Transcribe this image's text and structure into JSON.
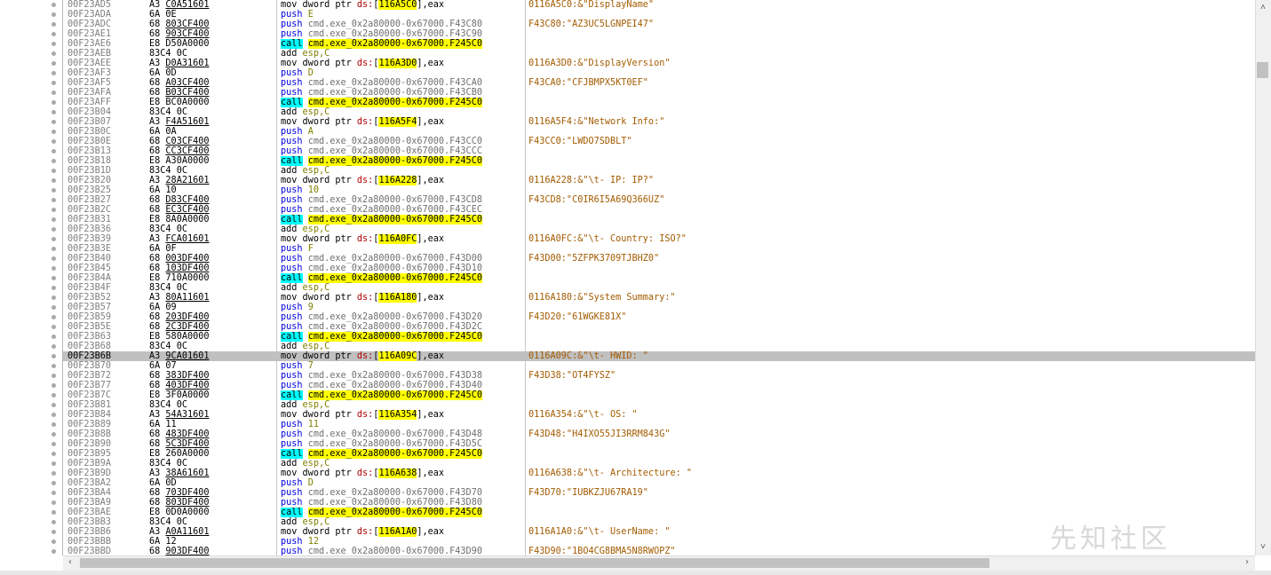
{
  "rows": [
    {
      "addr": "00F23AD5",
      "bp": true,
      "b1": "A3",
      "b2": "C0A51601",
      "u": true,
      "op": "mov",
      "ins": "mov",
      "a1": "dword ptr ",
      "seg": "ds:",
      "mem": "116A5C0",
      "tail": ",eax",
      "cmt": "0116A5C0:&\"DisplayName\""
    },
    {
      "addr": "00F23ADA",
      "bp": true,
      "b1": "6A",
      "b2": "0E",
      "u": false,
      "op": "push",
      "ins": "push",
      "a1": "E",
      "cmt": ""
    },
    {
      "addr": "00F23ADC",
      "bp": true,
      "b1": "68",
      "b2": "803CF400",
      "u": true,
      "op": "push",
      "ins": "push",
      "a1": "cmd.exe_0x2a80000-0x67000.F43C80",
      "cmt": "F43C80:\"AZ3UC5LGNPEI47\""
    },
    {
      "addr": "00F23AE1",
      "bp": true,
      "b1": "68",
      "b2": "903CF400",
      "u": true,
      "op": "push",
      "ins": "push",
      "a1": "cmd.exe_0x2a80000-0x67000.F43C90",
      "cmt": ""
    },
    {
      "addr": "00F23AE6",
      "bp": true,
      "b1": "E8",
      "b2": "D50A0000",
      "u": false,
      "op": "call",
      "ins": "call",
      "a1": "cmd.exe_0x2a80000-0x67000.F245C0",
      "cmt": ""
    },
    {
      "addr": "00F23AEB",
      "bp": true,
      "b1": "83C4",
      "b2": "0C",
      "u": false,
      "op": "add",
      "ins": "add",
      "a1": "esp,C",
      "cmt": ""
    },
    {
      "addr": "00F23AEE",
      "bp": true,
      "b1": "A3",
      "b2": "D0A31601",
      "u": true,
      "op": "mov",
      "ins": "mov",
      "a1": "dword ptr ",
      "seg": "ds:",
      "mem": "116A3D0",
      "tail": ",eax",
      "cmt": "0116A3D0:&\"DisplayVersion\""
    },
    {
      "addr": "00F23AF3",
      "bp": true,
      "b1": "6A",
      "b2": "0D",
      "u": false,
      "op": "push",
      "ins": "push",
      "a1": "D",
      "cmt": ""
    },
    {
      "addr": "00F23AF5",
      "bp": true,
      "b1": "68",
      "b2": "A03CF400",
      "u": true,
      "op": "push",
      "ins": "push",
      "a1": "cmd.exe_0x2a80000-0x67000.F43CA0",
      "cmt": "F43CA0:\"CFJBMPX5KT0EF\""
    },
    {
      "addr": "00F23AFA",
      "bp": true,
      "b1": "68",
      "b2": "B03CF400",
      "u": true,
      "op": "push",
      "ins": "push",
      "a1": "cmd.exe_0x2a80000-0x67000.F43CB0",
      "cmt": ""
    },
    {
      "addr": "00F23AFF",
      "bp": true,
      "b1": "E8",
      "b2": "BC0A0000",
      "u": false,
      "op": "call",
      "ins": "call",
      "a1": "cmd.exe_0x2a80000-0x67000.F245C0",
      "cmt": ""
    },
    {
      "addr": "00F23B04",
      "bp": true,
      "b1": "83C4",
      "b2": "0C",
      "u": false,
      "op": "add",
      "ins": "add",
      "a1": "esp,C",
      "cmt": ""
    },
    {
      "addr": "00F23B07",
      "bp": true,
      "b1": "A3",
      "b2": "F4A51601",
      "u": true,
      "op": "mov",
      "ins": "mov",
      "a1": "dword ptr ",
      "seg": "ds:",
      "mem": "116A5F4",
      "tail": ",eax",
      "cmt": "0116A5F4:&\"Network Info:\""
    },
    {
      "addr": "00F23B0C",
      "bp": true,
      "b1": "6A",
      "b2": "0A",
      "u": false,
      "op": "push",
      "ins": "push",
      "a1": "A",
      "cmt": ""
    },
    {
      "addr": "00F23B0E",
      "bp": true,
      "b1": "68",
      "b2": "C03CF400",
      "u": true,
      "op": "push",
      "ins": "push",
      "a1": "cmd.exe_0x2a80000-0x67000.F43CC0",
      "cmt": "F43CC0:\"LWDO7SDBLT\""
    },
    {
      "addr": "00F23B13",
      "bp": true,
      "b1": "68",
      "b2": "CC3CF400",
      "u": true,
      "op": "push",
      "ins": "push",
      "a1": "cmd.exe_0x2a80000-0x67000.F43CCC",
      "cmt": ""
    },
    {
      "addr": "00F23B18",
      "bp": true,
      "b1": "E8",
      "b2": "A30A0000",
      "u": false,
      "op": "call",
      "ins": "call",
      "a1": "cmd.exe_0x2a80000-0x67000.F245C0",
      "cmt": ""
    },
    {
      "addr": "00F23B1D",
      "bp": true,
      "b1": "83C4",
      "b2": "0C",
      "u": false,
      "op": "add",
      "ins": "add",
      "a1": "esp,C",
      "cmt": ""
    },
    {
      "addr": "00F23B20",
      "bp": true,
      "b1": "A3",
      "b2": "28A21601",
      "u": true,
      "op": "mov",
      "ins": "mov",
      "a1": "dword ptr ",
      "seg": "ds:",
      "mem": "116A228",
      "tail": ",eax",
      "cmt": "0116A228:&\"\\t- IP: IP?\""
    },
    {
      "addr": "00F23B25",
      "bp": true,
      "b1": "6A",
      "b2": "10",
      "u": false,
      "op": "push",
      "ins": "push",
      "a1": "10",
      "cmt": ""
    },
    {
      "addr": "00F23B27",
      "bp": true,
      "b1": "68",
      "b2": "D83CF400",
      "u": true,
      "op": "push",
      "ins": "push",
      "a1": "cmd.exe_0x2a80000-0x67000.F43CD8",
      "cmt": "F43CD8:\"C0IR6I5A69Q366UZ\""
    },
    {
      "addr": "00F23B2C",
      "bp": true,
      "b1": "68",
      "b2": "EC3CF400",
      "u": true,
      "op": "push",
      "ins": "push",
      "a1": "cmd.exe_0x2a80000-0x67000.F43CEC",
      "cmt": ""
    },
    {
      "addr": "00F23B31",
      "bp": true,
      "b1": "E8",
      "b2": "8A0A0000",
      "u": false,
      "op": "call",
      "ins": "call",
      "a1": "cmd.exe_0x2a80000-0x67000.F245C0",
      "cmt": ""
    },
    {
      "addr": "00F23B36",
      "bp": true,
      "b1": "83C4",
      "b2": "0C",
      "u": false,
      "op": "add",
      "ins": "add",
      "a1": "esp,C",
      "cmt": ""
    },
    {
      "addr": "00F23B39",
      "bp": true,
      "b1": "A3",
      "b2": "FCA01601",
      "u": true,
      "op": "mov",
      "ins": "mov",
      "a1": "dword ptr ",
      "seg": "ds:",
      "mem": "116A0FC",
      "tail": ",eax",
      "cmt": "0116A0FC:&\"\\t- Country: ISO?\""
    },
    {
      "addr": "00F23B3E",
      "bp": true,
      "b1": "6A",
      "b2": "0F",
      "u": false,
      "op": "push",
      "ins": "push",
      "a1": "F",
      "cmt": ""
    },
    {
      "addr": "00F23B40",
      "bp": true,
      "b1": "68",
      "b2": "003DF400",
      "u": true,
      "op": "push",
      "ins": "push",
      "a1": "cmd.exe_0x2a80000-0x67000.F43D00",
      "cmt": "F43D00:\"5ZFPK3709TJBHZ0\""
    },
    {
      "addr": "00F23B45",
      "bp": true,
      "b1": "68",
      "b2": "103DF400",
      "u": true,
      "op": "push",
      "ins": "push",
      "a1": "cmd.exe_0x2a80000-0x67000.F43D10",
      "cmt": ""
    },
    {
      "addr": "00F23B4A",
      "bp": true,
      "b1": "E8",
      "b2": "710A0000",
      "u": false,
      "op": "call",
      "ins": "call",
      "a1": "cmd.exe_0x2a80000-0x67000.F245C0",
      "cmt": ""
    },
    {
      "addr": "00F23B4F",
      "bp": true,
      "b1": "83C4",
      "b2": "0C",
      "u": false,
      "op": "add",
      "ins": "add",
      "a1": "esp,C",
      "cmt": ""
    },
    {
      "addr": "00F23B52",
      "bp": true,
      "b1": "A3",
      "b2": "80A11601",
      "u": true,
      "op": "mov",
      "ins": "mov",
      "a1": "dword ptr ",
      "seg": "ds:",
      "mem": "116A180",
      "tail": ",eax",
      "cmt": "0116A180:&\"System Summary:\""
    },
    {
      "addr": "00F23B57",
      "bp": true,
      "b1": "6A",
      "b2": "09",
      "u": false,
      "op": "push",
      "ins": "push",
      "a1": "9",
      "cmt": ""
    },
    {
      "addr": "00F23B59",
      "bp": true,
      "b1": "68",
      "b2": "203DF400",
      "u": true,
      "op": "push",
      "ins": "push",
      "a1": "cmd.exe_0x2a80000-0x67000.F43D20",
      "cmt": "F43D20:\"61WGKE81X\""
    },
    {
      "addr": "00F23B5E",
      "bp": true,
      "b1": "68",
      "b2": "2C3DF400",
      "u": true,
      "op": "push",
      "ins": "push",
      "a1": "cmd.exe_0x2a80000-0x67000.F43D2C",
      "cmt": ""
    },
    {
      "addr": "00F23B63",
      "bp": true,
      "b1": "E8",
      "b2": "580A0000",
      "u": false,
      "op": "call",
      "ins": "call",
      "a1": "cmd.exe_0x2a80000-0x67000.F245C0",
      "cmt": ""
    },
    {
      "addr": "00F23B68",
      "bp": true,
      "b1": "83C4",
      "b2": "0C",
      "u": false,
      "op": "add",
      "ins": "add",
      "a1": "esp,C",
      "cmt": ""
    },
    {
      "addr": "00F23B6B",
      "bp": true,
      "sel": true,
      "b1": "A3",
      "b2": "9CA01601",
      "u": true,
      "op": "mov",
      "ins": "mov",
      "a1": "dword ptr ",
      "seg": "ds:",
      "mem": "116A09C",
      "tail": ",eax",
      "cmt": "0116A09C:&\"\\t- HWID: \""
    },
    {
      "addr": "00F23B70",
      "bp": true,
      "b1": "6A",
      "b2": "07",
      "u": false,
      "op": "push",
      "ins": "push",
      "a1": "7",
      "cmt": ""
    },
    {
      "addr": "00F23B72",
      "bp": true,
      "b1": "68",
      "b2": "383DF400",
      "u": true,
      "op": "push",
      "ins": "push",
      "a1": "cmd.exe_0x2a80000-0x67000.F43D38",
      "cmt": "F43D38:\"OT4FYSZ\""
    },
    {
      "addr": "00F23B77",
      "bp": true,
      "b1": "68",
      "b2": "403DF400",
      "u": true,
      "op": "push",
      "ins": "push",
      "a1": "cmd.exe_0x2a80000-0x67000.F43D40",
      "cmt": ""
    },
    {
      "addr": "00F23B7C",
      "bp": true,
      "b1": "E8",
      "b2": "3F0A0000",
      "u": false,
      "op": "call",
      "ins": "call",
      "a1": "cmd.exe_0x2a80000-0x67000.F245C0",
      "cmt": ""
    },
    {
      "addr": "00F23B81",
      "bp": true,
      "b1": "83C4",
      "b2": "0C",
      "u": false,
      "op": "add",
      "ins": "add",
      "a1": "esp,C",
      "cmt": ""
    },
    {
      "addr": "00F23B84",
      "bp": true,
      "b1": "A3",
      "b2": "54A31601",
      "u": true,
      "op": "mov",
      "ins": "mov",
      "a1": "dword ptr ",
      "seg": "ds:",
      "mem": "116A354",
      "tail": ",eax",
      "cmt": "0116A354:&\"\\t- OS: \""
    },
    {
      "addr": "00F23B89",
      "bp": true,
      "b1": "6A",
      "b2": "11",
      "u": false,
      "op": "push",
      "ins": "push",
      "a1": "11",
      "cmt": ""
    },
    {
      "addr": "00F23B8B",
      "bp": true,
      "b1": "68",
      "b2": "483DF400",
      "u": true,
      "op": "push",
      "ins": "push",
      "a1": "cmd.exe_0x2a80000-0x67000.F43D48",
      "cmt": "F43D48:\"H4IXO55JI3RRM843G\""
    },
    {
      "addr": "00F23B90",
      "bp": true,
      "b1": "68",
      "b2": "5C3DF400",
      "u": true,
      "op": "push",
      "ins": "push",
      "a1": "cmd.exe_0x2a80000-0x67000.F43D5C",
      "cmt": ""
    },
    {
      "addr": "00F23B95",
      "bp": true,
      "b1": "E8",
      "b2": "260A0000",
      "u": false,
      "op": "call",
      "ins": "call",
      "a1": "cmd.exe_0x2a80000-0x67000.F245C0",
      "cmt": ""
    },
    {
      "addr": "00F23B9A",
      "bp": true,
      "b1": "83C4",
      "b2": "0C",
      "u": false,
      "op": "add",
      "ins": "add",
      "a1": "esp,C",
      "cmt": ""
    },
    {
      "addr": "00F23B9D",
      "bp": true,
      "b1": "A3",
      "b2": "38A61601",
      "u": true,
      "op": "mov",
      "ins": "mov",
      "a1": "dword ptr ",
      "seg": "ds:",
      "mem": "116A638",
      "tail": ",eax",
      "cmt": "0116A638:&\"\\t- Architecture: \""
    },
    {
      "addr": "00F23BA2",
      "bp": true,
      "b1": "6A",
      "b2": "0D",
      "u": false,
      "op": "push",
      "ins": "push",
      "a1": "D",
      "cmt": ""
    },
    {
      "addr": "00F23BA4",
      "bp": true,
      "b1": "68",
      "b2": "703DF400",
      "u": true,
      "op": "push",
      "ins": "push",
      "a1": "cmd.exe_0x2a80000-0x67000.F43D70",
      "cmt": "F43D70:\"IUBKZJU67RA19\""
    },
    {
      "addr": "00F23BA9",
      "bp": true,
      "b1": "68",
      "b2": "803DF400",
      "u": true,
      "op": "push",
      "ins": "push",
      "a1": "cmd.exe_0x2a80000-0x67000.F43D80",
      "cmt": ""
    },
    {
      "addr": "00F23BAE",
      "bp": true,
      "b1": "E8",
      "b2": "0D0A0000",
      "u": false,
      "op": "call",
      "ins": "call",
      "a1": "cmd.exe_0x2a80000-0x67000.F245C0",
      "cmt": ""
    },
    {
      "addr": "00F23BB3",
      "bp": true,
      "b1": "83C4",
      "b2": "0C",
      "u": false,
      "op": "add",
      "ins": "add",
      "a1": "esp,C",
      "cmt": ""
    },
    {
      "addr": "00F23BB6",
      "bp": true,
      "b1": "A3",
      "b2": "A0A11601",
      "u": true,
      "op": "mov",
      "ins": "mov",
      "a1": "dword ptr ",
      "seg": "ds:",
      "mem": "116A1A0",
      "tail": ",eax",
      "cmt": "0116A1A0:&\"\\t- UserName: \""
    },
    {
      "addr": "00F23BBB",
      "bp": true,
      "b1": "6A",
      "b2": "12",
      "u": false,
      "op": "push",
      "ins": "push",
      "a1": "12",
      "cmt": ""
    },
    {
      "addr": "00F23BBD",
      "bp": true,
      "b1": "68",
      "b2": "903DF400",
      "u": true,
      "op": "push",
      "ins": "push",
      "a1": "cmd.exe_0x2a80000-0x67000.F43D90",
      "cmt": "F43D90:\"1BO4CG8BMA5N8RWOPZ\""
    }
  ],
  "scroll": {
    "up_arrow": "˄",
    "down_arrow": "˅",
    "left_arrow": "‹",
    "right_arrow": "›"
  },
  "watermark": "先知社区",
  "colors": {
    "selected_row": "#c0c0c0",
    "call_highlight": "#00ffff",
    "mem_highlight": "#ffff00",
    "comment": "#a35b00",
    "push_keyword": "#0000e0"
  }
}
